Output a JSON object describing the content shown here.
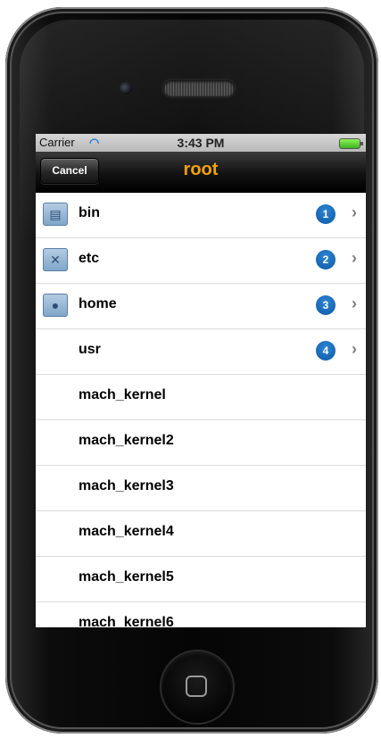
{
  "status_bar": {
    "carrier": "Carrier",
    "time": "3:43 PM",
    "wifi_icon": "wifi-icon",
    "battery_icon": "battery-icon"
  },
  "navbar": {
    "cancel_label": "Cancel",
    "title": "root",
    "title_color": "#f5a300"
  },
  "rows": [
    {
      "label": "bin",
      "icon": "folder-icon",
      "badge": "1"
    },
    {
      "label": "etc",
      "icon": "tools-folder-icon",
      "badge": "2"
    },
    {
      "label": "home",
      "icon": "home-folder-icon",
      "badge": "3"
    },
    {
      "label": "usr",
      "badge": "4"
    },
    {
      "label": "mach_kernel"
    },
    {
      "label": "mach_kernel2"
    },
    {
      "label": "mach_kernel3"
    },
    {
      "label": "mach_kernel4"
    },
    {
      "label": "mach_kernel5"
    },
    {
      "label": "mach_kernel6"
    }
  ],
  "colors": {
    "badge_blue": "#0b58a6",
    "device_black": "#050505"
  }
}
